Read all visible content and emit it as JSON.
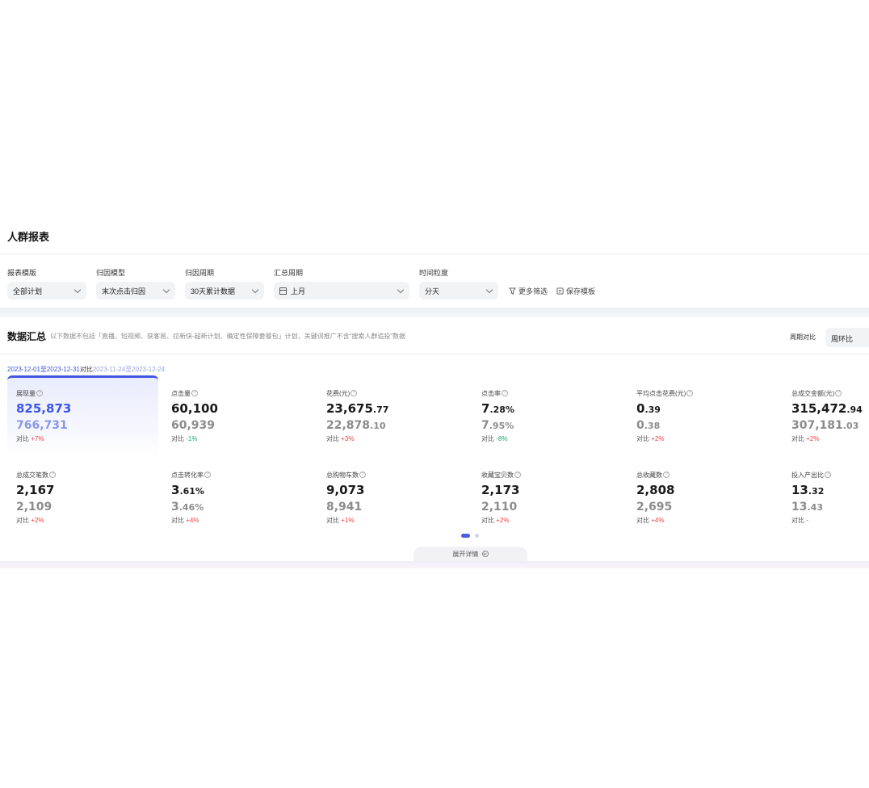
{
  "header": {
    "title": "人群报表"
  },
  "filters": [
    {
      "label": "报表模版",
      "value": "全部计划"
    },
    {
      "label": "归因模型",
      "value": "末次点击归因"
    },
    {
      "label": "归因周期",
      "value": "30天累计数据"
    },
    {
      "label": "汇总周期",
      "value": "上月"
    },
    {
      "label": "时间粒度",
      "value": "分天"
    }
  ],
  "actions": {
    "more_filter": "更多筛选",
    "save_template": "保存模板"
  },
  "summary": {
    "title": "数据汇总",
    "note": "以下数据不包括「直播、短视频、获客易、拉新快-超新计划、确定性保障套餐包」计划，关键词推广不含“搜索人群追投”数据",
    "cycle_label": "周期对比",
    "cycle_value": "周环比",
    "date_current": "2023-12-01至2023-12-31",
    "date_vs": "对比",
    "date_compare": "2023-11-24至2023-12-24",
    "delta_prefix": "对比"
  },
  "metrics": [
    {
      "label": "展现量",
      "value_int": "825,873",
      "value_dec": "",
      "compare_int": "766,731",
      "compare_dec": "",
      "delta": "+7%",
      "direction": "up",
      "active": true
    },
    {
      "label": "点击量",
      "value_int": "60,100",
      "value_dec": "",
      "compare_int": "60,939",
      "compare_dec": "",
      "delta": "-1%",
      "direction": "down"
    },
    {
      "label": "花费(元)",
      "value_int": "23,675",
      "value_dec": ".77",
      "compare_int": "22,878",
      "compare_dec": ".10",
      "delta": "+3%",
      "direction": "up"
    },
    {
      "label": "点击率",
      "value_int": "7",
      "value_dec": ".28%",
      "compare_int": "7",
      "compare_dec": ".95%",
      "delta": "-8%",
      "direction": "down"
    },
    {
      "label": "平均点击花费(元)",
      "value_int": "0",
      "value_dec": ".39",
      "compare_int": "0",
      "compare_dec": ".38",
      "delta": "+2%",
      "direction": "up"
    },
    {
      "label": "总成交金额(元)",
      "value_int": "315,472",
      "value_dec": ".94",
      "compare_int": "307,181",
      "compare_dec": ".03",
      "delta": "+2%",
      "direction": "up"
    },
    {
      "label": "总成交笔数",
      "value_int": "2,167",
      "value_dec": "",
      "compare_int": "2,109",
      "compare_dec": "",
      "delta": "+2%",
      "direction": "up"
    },
    {
      "label": "点击转化率",
      "value_int": "3",
      "value_dec": ".61%",
      "compare_int": "3",
      "compare_dec": ".46%",
      "delta": "+4%",
      "direction": "up"
    },
    {
      "label": "总购物车数",
      "value_int": "9,073",
      "value_dec": "",
      "compare_int": "8,941",
      "compare_dec": "",
      "delta": "+1%",
      "direction": "up"
    },
    {
      "label": "收藏宝贝数",
      "value_int": "2,173",
      "value_dec": "",
      "compare_int": "2,110",
      "compare_dec": "",
      "delta": "+2%",
      "direction": "up"
    },
    {
      "label": "总收藏数",
      "value_int": "2,808",
      "value_dec": "",
      "compare_int": "2,695",
      "compare_dec": "",
      "delta": "+4%",
      "direction": "up"
    },
    {
      "label": "投入产出比",
      "value_int": "13",
      "value_dec": ".32",
      "compare_int": "13",
      "compare_dec": ".43",
      "delta": "-",
      "direction": "none"
    }
  ],
  "expand": {
    "label": "展开详情"
  },
  "colors": {
    "accent": "#3b55e6",
    "up": "#f04040",
    "down": "#17a86b"
  }
}
